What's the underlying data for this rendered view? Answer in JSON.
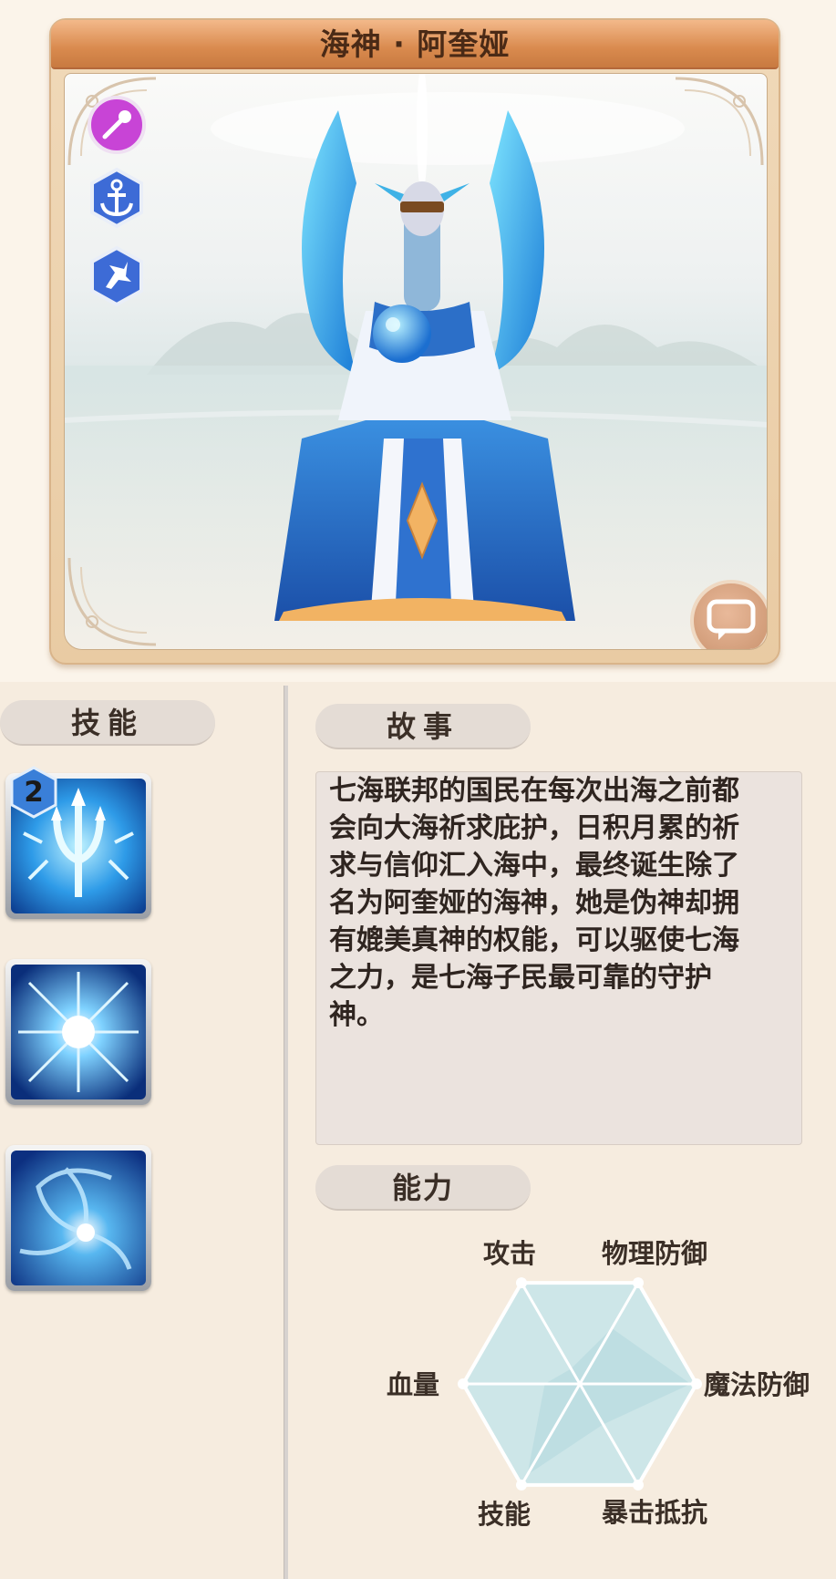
{
  "hero": {
    "name": "海神 · 阿奎娅",
    "class_icons": [
      "magic-staff-icon",
      "anchor-icon",
      "star-emblem-icon"
    ],
    "chat_icon": "speech-bubble-icon"
  },
  "skills": {
    "header": "技能",
    "items": [
      {
        "icon": "trident-skill-icon",
        "level": "2"
      },
      {
        "icon": "ice-burst-skill-icon"
      },
      {
        "icon": "whirlpool-skill-icon"
      }
    ]
  },
  "story": {
    "header": "故事",
    "text": "七海联邦的国民在每次出海之前都会向大海祈求庇护，日积月累的祈求与信仰汇入海中，最终诞生除了名为阿奎娅的海神，她是伪神却拥有媲美真神的权能，可以驱使七海之力，是七海子民最可靠的守护神。"
  },
  "ability": {
    "header": "能力",
    "axes": [
      "攻击",
      "物理防御",
      "魔法防御",
      "暴击抵抗",
      "技能",
      "血量"
    ],
    "values": [
      0.15,
      0.55,
      0.95,
      0.4,
      0.9,
      0.3
    ],
    "colors": {
      "fill": "#cde6e8",
      "accent": "#bcdde1",
      "stroke": "#ffffff"
    }
  }
}
